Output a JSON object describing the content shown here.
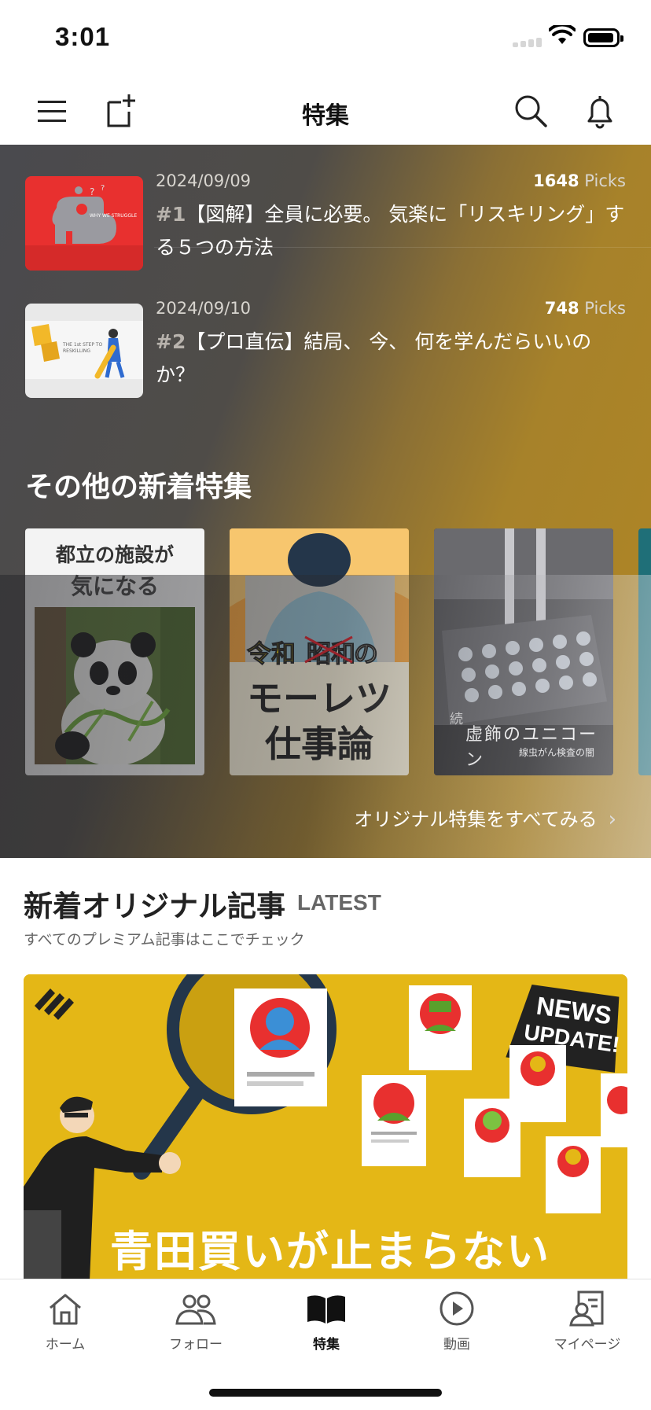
{
  "status_bar": {
    "time": "3:01"
  },
  "nav": {
    "title": "特集",
    "menu_icon": "hamburger-icon",
    "compose_icon": "new-post-icon",
    "search_icon": "search-icon",
    "bell_icon": "bell-icon"
  },
  "ranking": [
    {
      "date": "2024/09/09",
      "picks_count": "1648",
      "picks_unit": " Picks",
      "rank": "#1",
      "title": "【図解】全員に必要。 気楽に「リスキリング」する５つの方法"
    },
    {
      "date": "2024/09/10",
      "picks_count": "748",
      "picks_unit": " Picks",
      "rank": "#2",
      "title": "【プロ直伝】結局、 今、 何を学んだらいいのか？"
    }
  ],
  "other_features": {
    "title": "その他の新着特集",
    "cards": [
      {
        "line1": "都立の施設が",
        "line2": "気になる"
      },
      {
        "tag1": "令和",
        "tag2": "昭和",
        "tag3": "の",
        "line1": "モーレツ",
        "line2": "仕事論"
      },
      {
        "small": "続",
        "line1": "虚飾のユニコーン",
        "line2": "線虫がん検査の闇"
      }
    ],
    "see_all": "オリジナル特集をすべてみる"
  },
  "latest": {
    "title": "新着オリジナル記事",
    "tag": "LATEST",
    "subtitle": "すべてのプレミアム記事はここでチェック",
    "feature_caption": "青田買いが止まらない",
    "badge_line1": "NEWS",
    "badge_line2": "UPDATE!"
  },
  "tabbar": [
    {
      "label": "ホーム",
      "icon": "home-icon"
    },
    {
      "label": "フォロー",
      "icon": "people-icon"
    },
    {
      "label": "特集",
      "icon": "book-icon",
      "active": true
    },
    {
      "label": "動画",
      "icon": "play-icon"
    },
    {
      "label": "マイページ",
      "icon": "profile-icon"
    }
  ]
}
